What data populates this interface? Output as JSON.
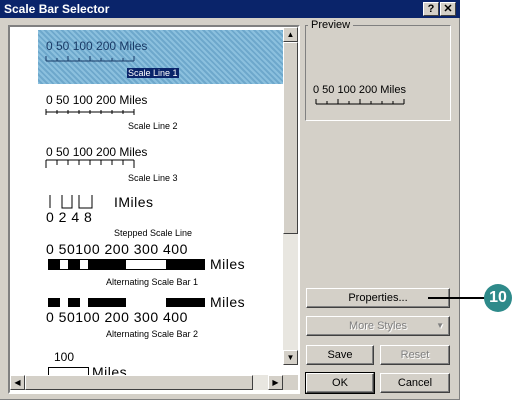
{
  "window": {
    "title": "Scale Bar Selector",
    "help_button": "?",
    "close_button": "✕"
  },
  "list": {
    "items": [
      {
        "numbers": "0  50 100     200 Miles",
        "caption": "Scale Line 1",
        "selected": true
      },
      {
        "numbers": "0  50 100     200 Miles",
        "caption": "Scale Line 2"
      },
      {
        "numbers": "0  50 100     200 Miles",
        "caption": "Scale Line 3"
      },
      {
        "numbers_top": "IMiles",
        "numbers_bottom": "0   2   4        8",
        "caption": "Stepped Scale Line"
      },
      {
        "numbers": "0  50100   200   300   400",
        "unit": "Miles",
        "caption": "Alternating Scale Bar 1"
      },
      {
        "numbers": "0  50100   200   300   400",
        "unit": "Miles",
        "caption": "Alternating Scale Bar 2"
      },
      {
        "numbers": "100",
        "unit": "Miles"
      }
    ]
  },
  "preview": {
    "label": "Preview",
    "text": "0   50 100     200 Miles"
  },
  "buttons": {
    "properties": "Properties...",
    "more_styles": "More Styles",
    "save": "Save",
    "reset": "Reset",
    "ok": "OK",
    "cancel": "Cancel"
  },
  "callout": {
    "number": "10"
  },
  "colors": {
    "titlebar": "#0a246a",
    "selection": "#0a246a",
    "callout": "#2e8a8a",
    "face": "#d4d0c8"
  }
}
